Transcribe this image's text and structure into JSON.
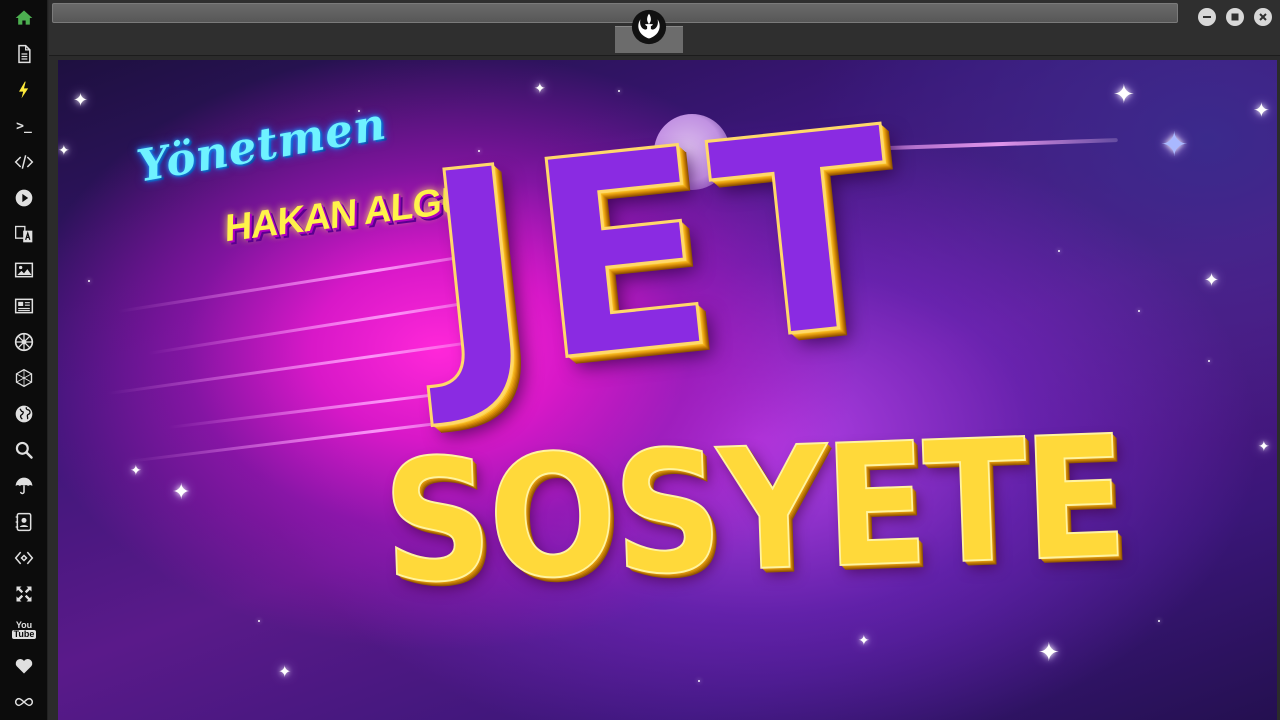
{
  "sidebar": {
    "items": [
      {
        "name": "home",
        "icon": "home-icon",
        "active": true
      },
      {
        "name": "document",
        "icon": "document-icon"
      },
      {
        "name": "lightning",
        "icon": "lightning-icon"
      },
      {
        "name": "terminal",
        "icon": "terminal-icon",
        "glyph": ">_"
      },
      {
        "name": "code",
        "icon": "code-icon"
      },
      {
        "name": "play",
        "icon": "play-icon"
      },
      {
        "name": "translate",
        "icon": "translate-icon"
      },
      {
        "name": "image",
        "icon": "image-icon"
      },
      {
        "name": "news",
        "icon": "news-icon"
      },
      {
        "name": "empire",
        "icon": "empire-icon"
      },
      {
        "name": "hexagon",
        "icon": "hexagon-icon"
      },
      {
        "name": "globe",
        "icon": "globe-icon"
      },
      {
        "name": "search",
        "icon": "search-icon"
      },
      {
        "name": "umbrella",
        "icon": "umbrella-icon"
      },
      {
        "name": "contacts",
        "icon": "contacts-icon"
      },
      {
        "name": "exchange",
        "icon": "exchange-icon"
      },
      {
        "name": "fullscreen",
        "icon": "expand-icon"
      },
      {
        "name": "youtube",
        "icon": "youtube-icon",
        "label_top": "You",
        "label_bottom": "Tube"
      },
      {
        "name": "favorites",
        "icon": "heart-icon"
      },
      {
        "name": "infinity",
        "icon": "infinity-icon"
      }
    ],
    "colors": {
      "active": "#4caf50",
      "lightning": "#ffeb3b",
      "default": "#e0e0e0"
    }
  },
  "topbar": {
    "logo_icon": "rebel-alliance-icon",
    "window_buttons": [
      "minimize-icon",
      "maximize-icon",
      "close-icon"
    ]
  },
  "poster": {
    "director_label": "Yönetmen",
    "director_name": "HAKAN ALGÜL",
    "title_line1": "JET",
    "title_line2": "SOSYETE",
    "colors": {
      "title_purple": "#8a2be2",
      "title_gold": "#ffd93a",
      "neon_cyan": "#6ff2ff",
      "neon_yellow": "#fff34a"
    }
  }
}
